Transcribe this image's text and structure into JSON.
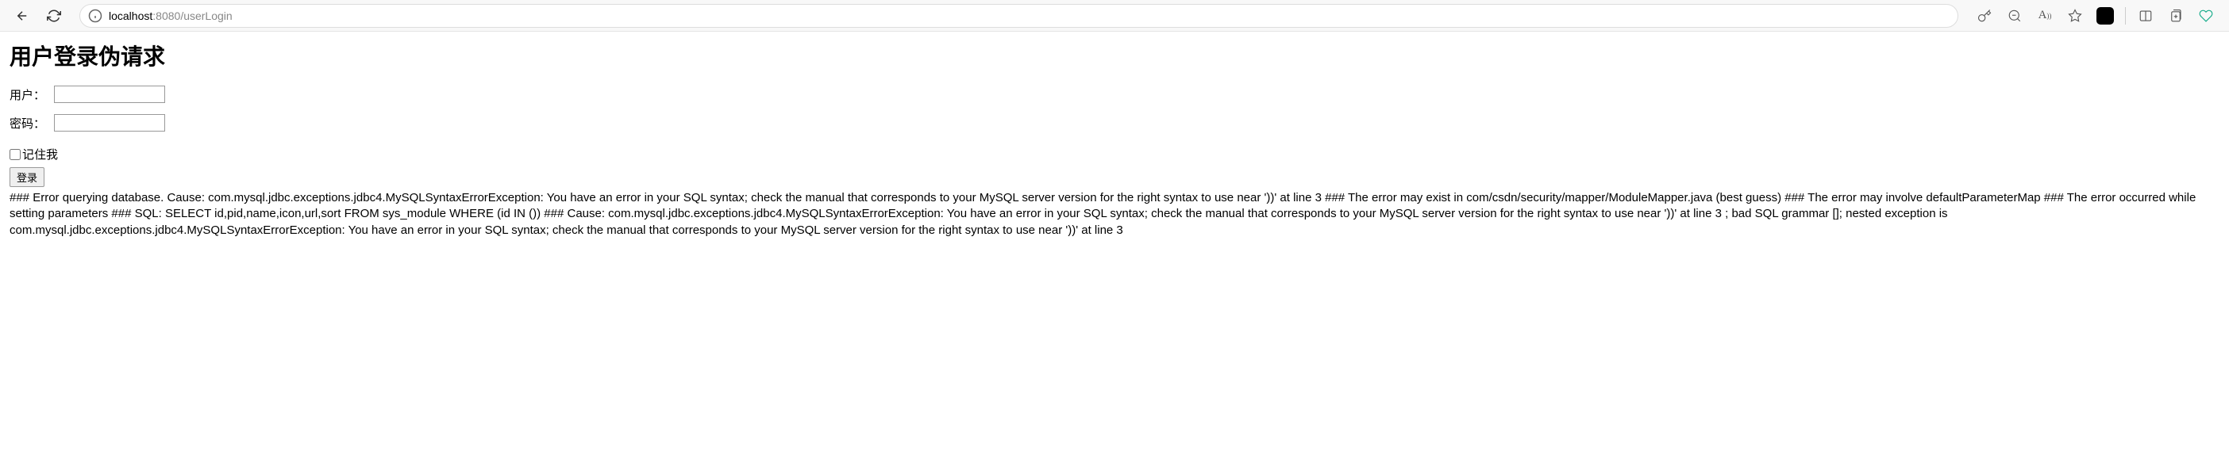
{
  "browser": {
    "url_host": "localhost",
    "url_port": ":8080",
    "url_path": "/userLogin"
  },
  "page": {
    "title": "用户登录伪请求",
    "username_label": "用户：",
    "username_value": "",
    "password_label": "密码：",
    "password_value": "",
    "remember_label": "记住我",
    "submit_label": "登录"
  },
  "error": {
    "message": "### Error querying database. Cause: com.mysql.jdbc.exceptions.jdbc4.MySQLSyntaxErrorException: You have an error in your SQL syntax; check the manual that corresponds to your MySQL server version for the right syntax to use near '))' at line 3 ### The error may exist in com/csdn/security/mapper/ModuleMapper.java (best guess) ### The error may involve defaultParameterMap ### The error occurred while setting parameters ### SQL: SELECT id,pid,name,icon,url,sort FROM sys_module WHERE (id IN ()) ### Cause: com.mysql.jdbc.exceptions.jdbc4.MySQLSyntaxErrorException: You have an error in your SQL syntax; check the manual that corresponds to your MySQL server version for the right syntax to use near '))' at line 3 ; bad SQL grammar []; nested exception is com.mysql.jdbc.exceptions.jdbc4.MySQLSyntaxErrorException: You have an error in your SQL syntax; check the manual that corresponds to your MySQL server version for the right syntax to use near '))' at line 3"
  }
}
